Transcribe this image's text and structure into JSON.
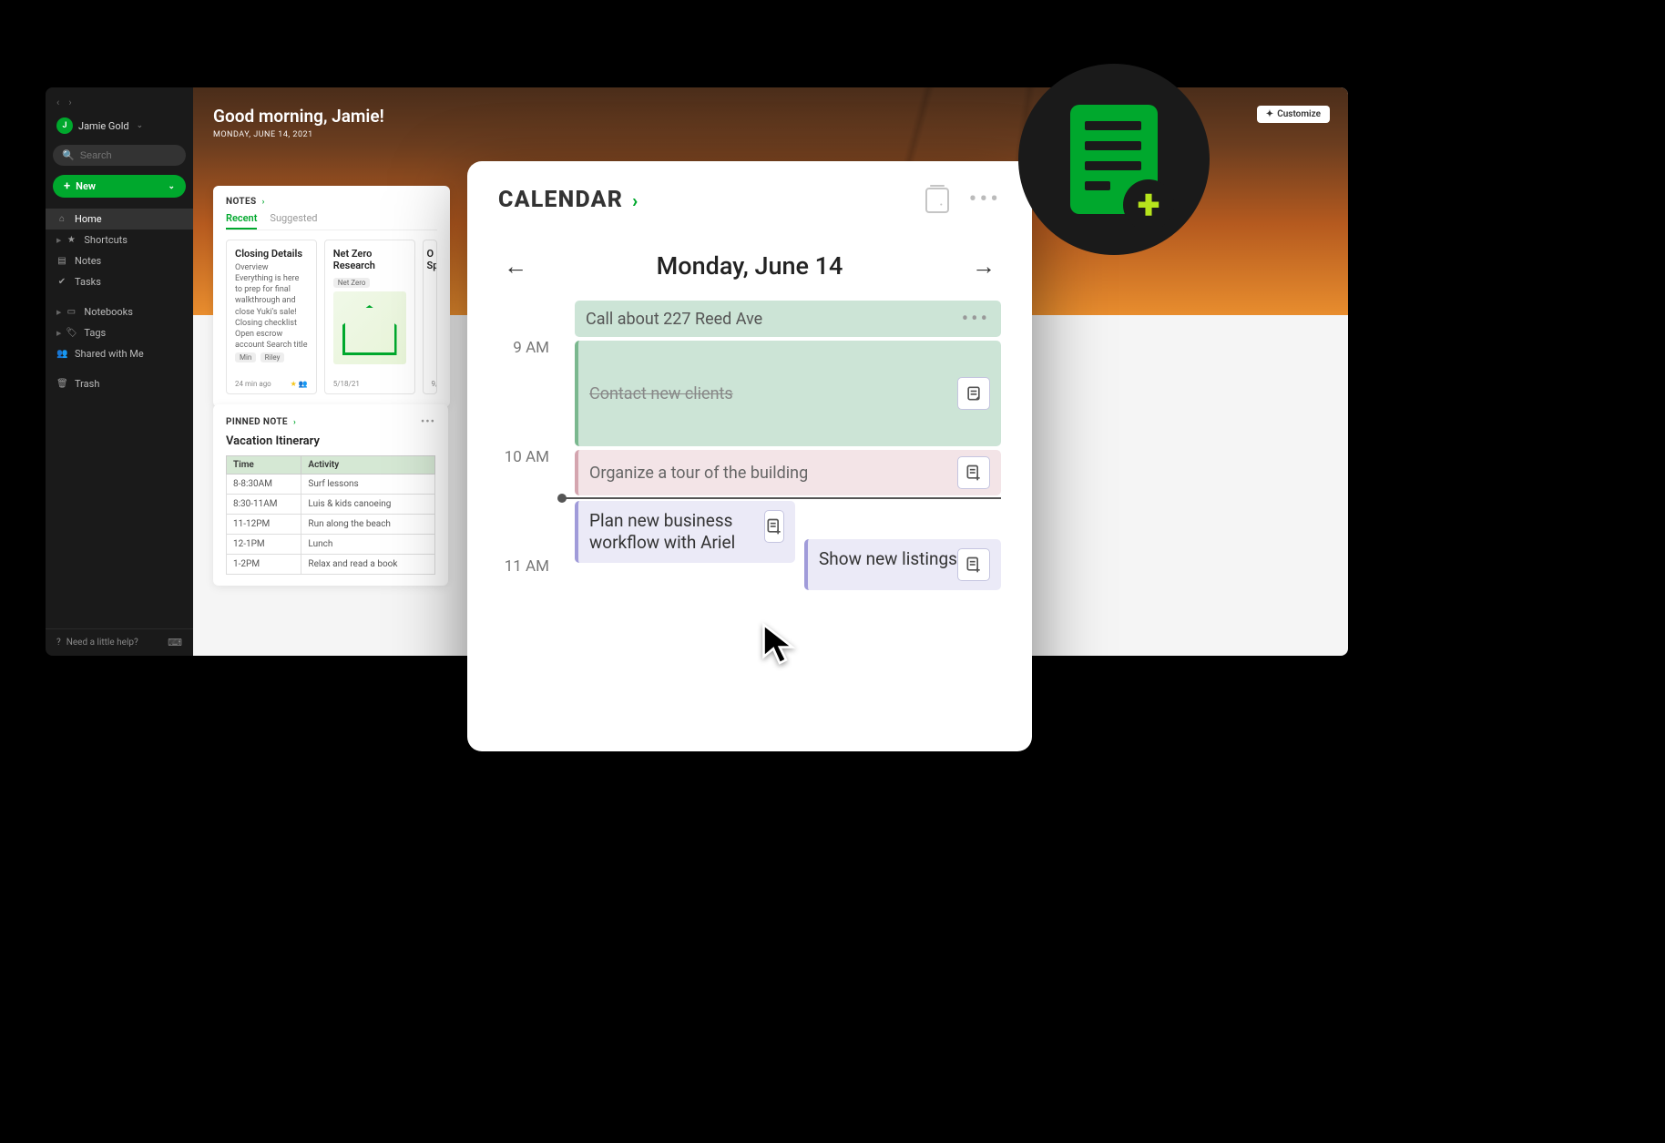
{
  "user": {
    "initial": "J",
    "name": "Jamie Gold"
  },
  "search": {
    "placeholder": "Search"
  },
  "new_button": {
    "label": "New"
  },
  "nav": {
    "home": "Home",
    "shortcuts": "Shortcuts",
    "notes": "Notes",
    "tasks": "Tasks",
    "notebooks": "Notebooks",
    "tags": "Tags",
    "shared": "Shared with Me",
    "trash": "Trash"
  },
  "help": {
    "label": "Need a little help?"
  },
  "hero": {
    "greeting": "Good morning, Jamie!",
    "date": "MONDAY, JUNE 14, 2021",
    "customize": "Customize"
  },
  "notes_widget": {
    "title": "NOTES",
    "tabs": {
      "recent": "Recent",
      "suggested": "Suggested"
    },
    "cards": [
      {
        "title": "Closing Details",
        "preview": "Overview Everything is here to prep for final walkthrough and close Yuki's sale! Closing checklist Open escrow account Search title and",
        "chips": [
          "Min",
          "Riley"
        ],
        "footer": "24 min ago"
      },
      {
        "title": "Net Zero Research",
        "chip": "Net Zero",
        "footer": "5/18/21"
      },
      {
        "title": "O\nSp",
        "footer": "9/"
      }
    ]
  },
  "pinned": {
    "title": "PINNED NOTE",
    "note_title": "Vacation Itinerary",
    "columns": [
      "Time",
      "Activity"
    ],
    "rows": [
      [
        "8-8:30AM",
        "Surf lessons"
      ],
      [
        "8:30-11AM",
        "Luis & kids canoeing"
      ],
      [
        "11-12PM",
        "Run along the beach"
      ],
      [
        "12-1PM",
        "Lunch"
      ],
      [
        "1-2PM",
        "Relax and read a book"
      ]
    ]
  },
  "calendar": {
    "title": "CALENDAR",
    "date": "Monday, June 14",
    "hours": [
      "9 AM",
      "10 AM",
      "11 AM"
    ],
    "events": {
      "allday": "Call about 227 Reed Ave",
      "e1": "Contact new clients",
      "e2": "Organize a tour of the building",
      "e3": "Plan new business workflow with Ariel",
      "e4": "Show new listings"
    }
  }
}
